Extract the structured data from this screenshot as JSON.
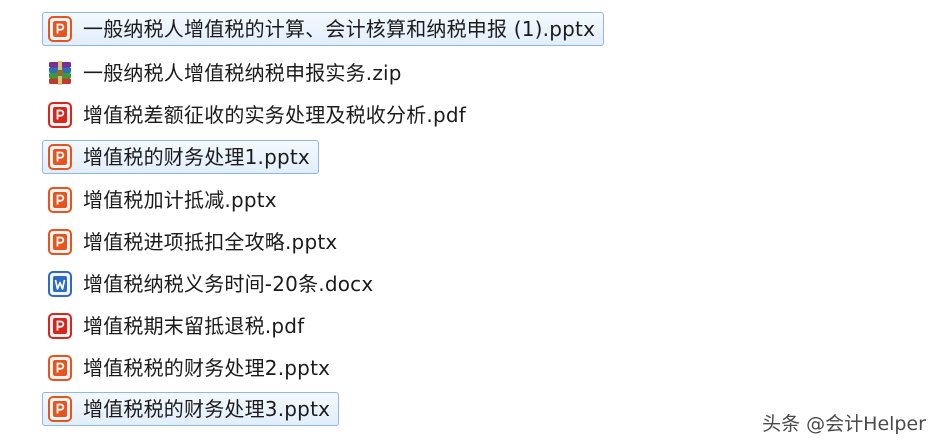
{
  "files": [
    {
      "name": "一般纳税人增值税的计算、会计核算和纳税申报 (1).pptx",
      "icon": "pptx-icon",
      "selected": true
    },
    {
      "name": "一般纳税人增值税纳税申报实务.zip",
      "icon": "zip-archive-icon",
      "selected": false
    },
    {
      "name": "增值税差额征收的实务处理及税收分析.pdf",
      "icon": "pdf-icon",
      "selected": false
    },
    {
      "name": "增值税的财务处理1.pptx",
      "icon": "pptx-icon",
      "selected": true
    },
    {
      "name": "增值税加计抵减.pptx",
      "icon": "pptx-icon",
      "selected": false
    },
    {
      "name": "增值税进项抵扣全攻略.pptx",
      "icon": "pptx-icon",
      "selected": false
    },
    {
      "name": "增值税纳税义务时间-20条.docx",
      "icon": "docx-icon",
      "selected": false
    },
    {
      "name": "增值税期末留抵退税.pdf",
      "icon": "pdf-icon",
      "selected": false
    },
    {
      "name": "增值税税的财务处理2.pptx",
      "icon": "pptx-icon",
      "selected": false
    },
    {
      "name": "增值税税的财务处理3.pptx",
      "icon": "pptx-icon",
      "selected": true
    }
  ],
  "watermark": "头条 @会计Helper",
  "colors": {
    "pptx": "#e8541e",
    "pdf": "#d8261c",
    "docx": "#2b6cc4",
    "selection_border": "#8fb8e6",
    "selection_fill": "#e1eefc"
  }
}
